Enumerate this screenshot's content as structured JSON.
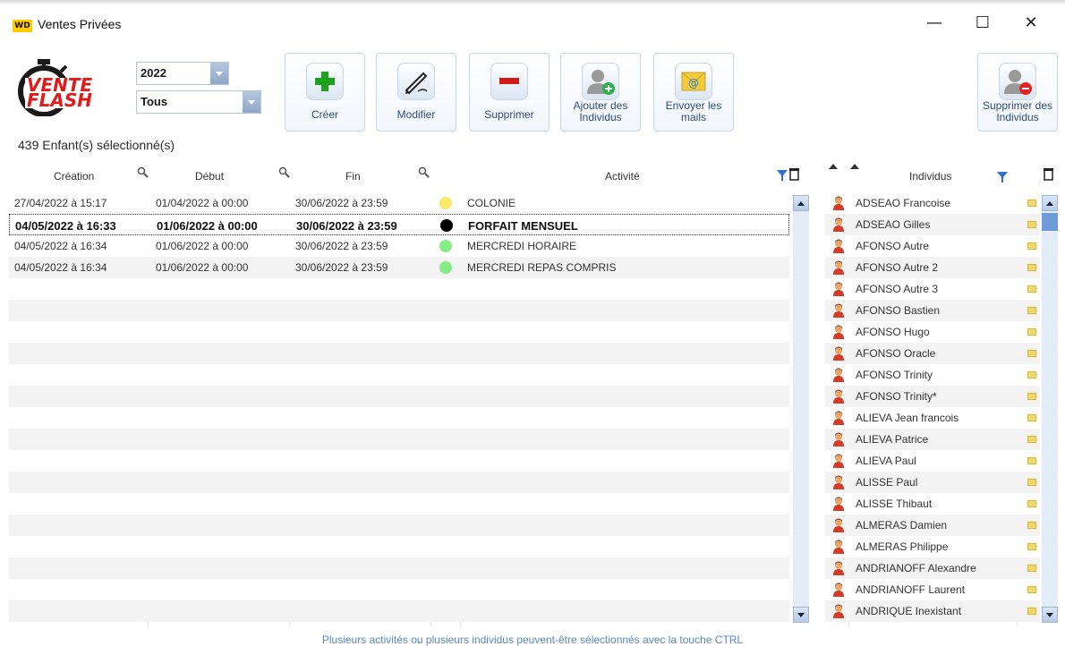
{
  "window": {
    "app_icon": "WD",
    "title": "Ventes Privées",
    "controls": {
      "minimize": "—",
      "maximize": "☐",
      "close": "✕"
    }
  },
  "logo": {
    "line1": "VENTE",
    "line2": "FLASH"
  },
  "filters": {
    "year": "2022",
    "category": "Tous"
  },
  "toolbar": [
    {
      "id": "create",
      "label": "Créer",
      "icon": "plus-icon"
    },
    {
      "id": "modify",
      "label": "Modifier",
      "icon": "pen-icon"
    },
    {
      "id": "delete",
      "label": "Supprimer",
      "icon": "minus-icon"
    },
    {
      "id": "add-individuals",
      "label": "Ajouter des Individus",
      "icon": "add-person-icon"
    },
    {
      "id": "send-mails",
      "label": "Envoyer les mails",
      "icon": "mail-icon"
    },
    {
      "id": "remove-individuals",
      "label": "Supprimer des Individus",
      "icon": "remove-person-icon"
    }
  ],
  "selection_count": "439 Enfant(s) sélectionné(s)",
  "table": {
    "columns": [
      "Création",
      "Début",
      "Fin",
      "Activité"
    ],
    "rows": [
      {
        "creation": "27/04/2022 à 15:17",
        "debut": "01/04/2022 à 00:00",
        "fin": "30/06/2022 à 23:59",
        "color": "#fbe96a",
        "activite": "COLONIE",
        "selected": false
      },
      {
        "creation": "04/05/2022 à 16:33",
        "debut": "01/06/2022 à 00:00",
        "fin": "30/06/2022 à 23:59",
        "color": "#000000",
        "activite": "FORFAIT MENSUEL",
        "selected": true
      },
      {
        "creation": "04/05/2022 à 16:34",
        "debut": "01/06/2022 à 00:00",
        "fin": "30/06/2022 à 23:59",
        "color": "#86ec86",
        "activite": "MERCREDI HORAIRE",
        "selected": false
      },
      {
        "creation": "04/05/2022 à 16:34",
        "debut": "01/06/2022 à 00:00",
        "fin": "30/06/2022 à 23:59",
        "color": "#86ec86",
        "activite": "MERCREDI REPAS COMPRIS",
        "selected": false
      }
    ]
  },
  "individuals": {
    "header": "Individus",
    "items": [
      "ADSEAO Francoise",
      "ADSEAO Gilles",
      "AFONSO Autre",
      "AFONSO Autre 2",
      "AFONSO Autre 3",
      "AFONSO Bastien",
      "AFONSO Hugo",
      "AFONSO Oracle",
      "AFONSO Trinity",
      "AFONSO Trinity*",
      "ALIEVA Jean francois",
      "ALIEVA Patrice",
      "ALIEVA Paul",
      "ALISSE Paul",
      "ALISSE Thibaut",
      "ALMERAS Damien",
      "ALMERAS Philippe",
      "ANDRIANOFF Alexandre",
      "ANDRIANOFF Laurent",
      "ANDRIQUE Inexistant"
    ]
  },
  "footer": "Plusieurs activités ou plusieurs individus peuvent-être sélectionnés avec la touche CTRL"
}
